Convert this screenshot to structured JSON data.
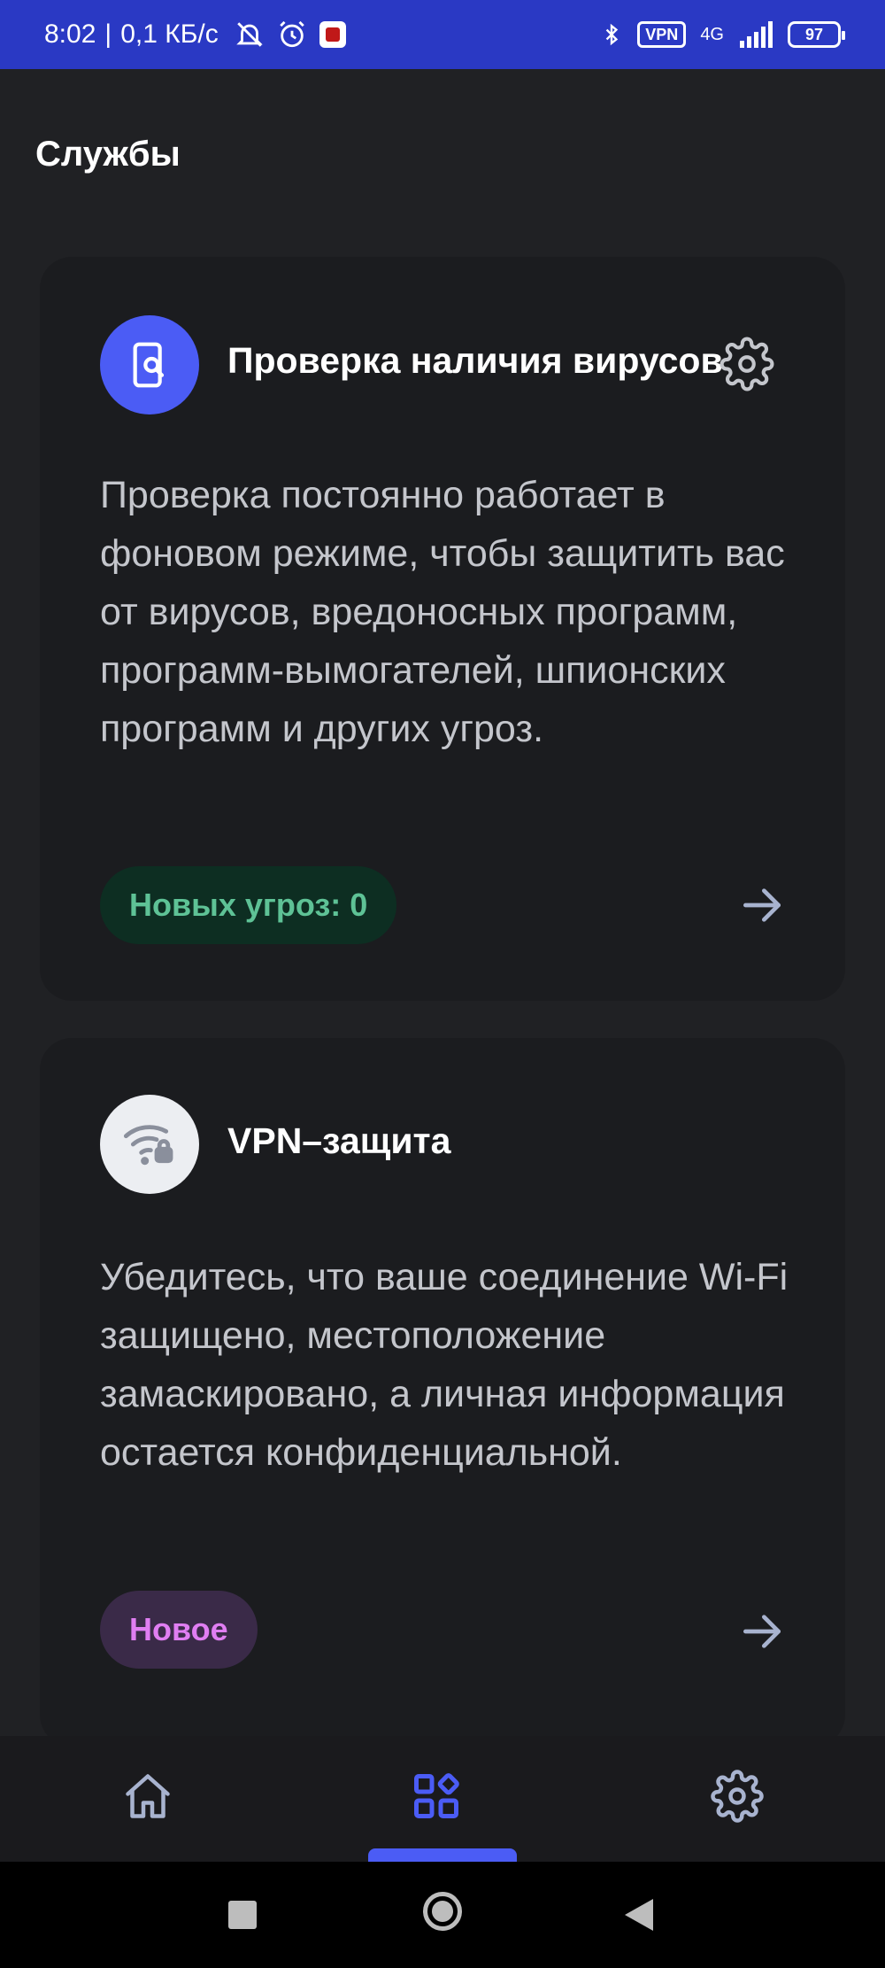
{
  "status_bar": {
    "time": "8:02",
    "separator": "|",
    "speed": "0,1 КБ/с",
    "vpn_label": "VPN",
    "network": "4G",
    "battery": "97"
  },
  "header": {
    "title": "Службы"
  },
  "cards": [
    {
      "title": "Проверка наличия вирусов",
      "description": "Проверка постоянно работает в фоновом режиме, чтобы защитить вас от вирусов, вредоносных программ, программ-вымогателей, шпионских программ и других угроз.",
      "badge": "Новых угроз: 0",
      "icon": "device-scan-icon",
      "accent": "#4b5cf5"
    },
    {
      "title": "VPN–защита",
      "description": "Убедитесь, что ваше соединение Wi-Fi защищено, местоположение замаскировано, а личная информация остается конфиденциальной.",
      "badge": "Новое",
      "icon": "wifi-lock-icon",
      "accent": "#e07ef2"
    }
  ],
  "bottom_nav": {
    "items": [
      "home-icon",
      "services-icon",
      "settings-icon"
    ],
    "active": "services-icon",
    "active_color": "#4b5cf5"
  }
}
